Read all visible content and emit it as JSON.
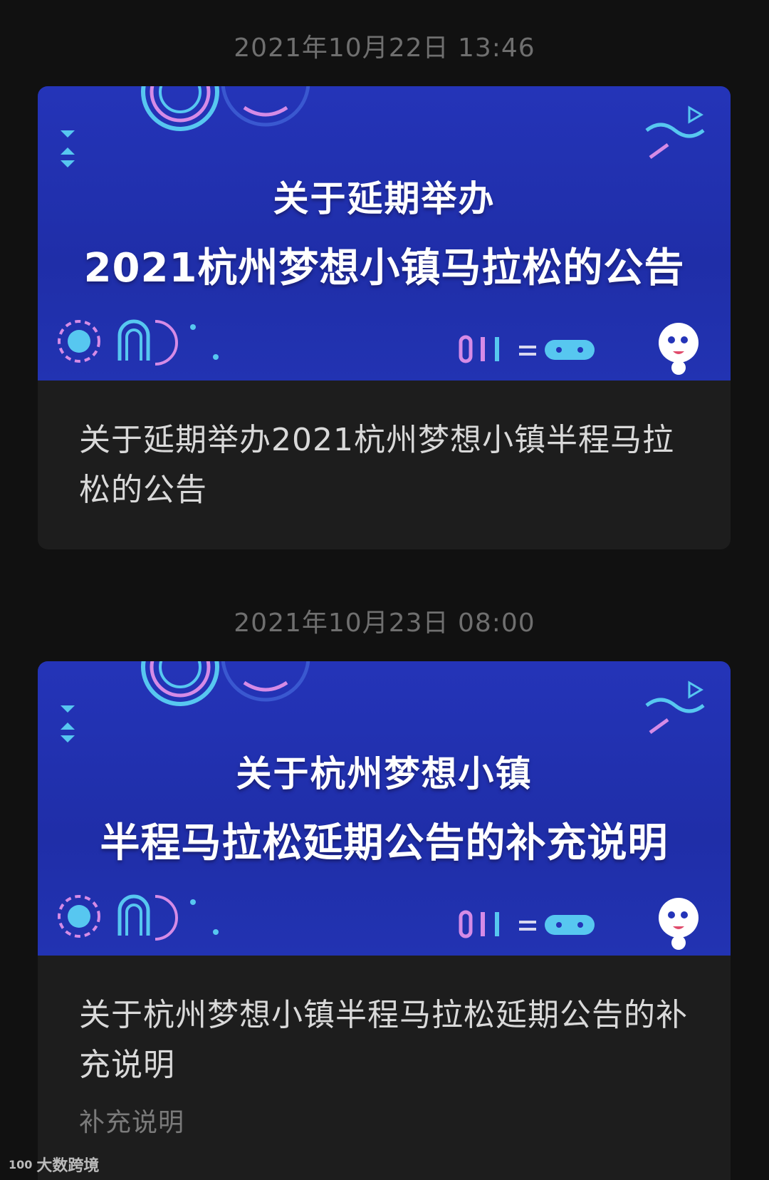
{
  "messages": [
    {
      "timestamp": "2021年10月22日 13:46",
      "banner_line1": "关于延期举办",
      "banner_line2": "2021杭州梦想小镇马拉松的公告",
      "title": "关于延期举办2021杭州梦想小镇半程马拉松的公告",
      "description": ""
    },
    {
      "timestamp": "2021年10月23日 08:00",
      "banner_line1": "关于杭州梦想小镇",
      "banner_line2": "半程马拉松延期公告的补充说明",
      "title": "关于杭州梦想小镇半程马拉松延期公告的补充说明",
      "description": "补充说明"
    }
  ],
  "watermark": {
    "logo": "100",
    "text": "大数跨境"
  },
  "colors": {
    "background": "#111111",
    "card": "#1d1d1d",
    "banner_blue": "#2434b8",
    "accent_pink": "#d58be6",
    "accent_cyan": "#57c7f0"
  }
}
